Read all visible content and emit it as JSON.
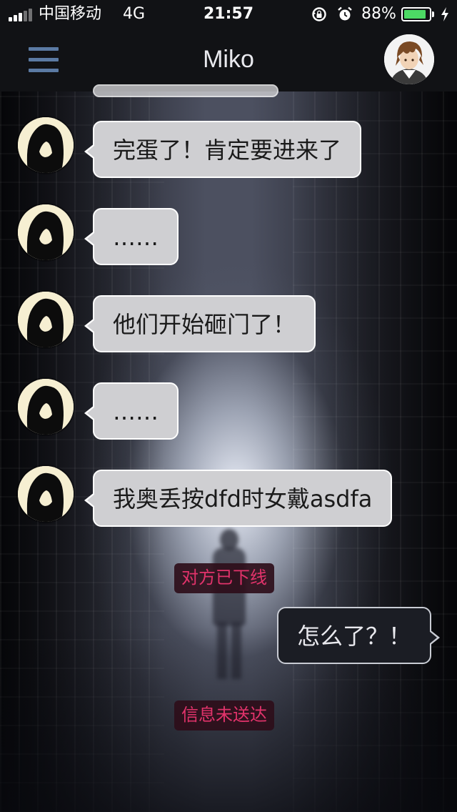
{
  "status_bar": {
    "carrier": "中国移动",
    "network": "4G",
    "time": "21:57",
    "battery_percent": "88%",
    "battery_level": 0.88,
    "icons": [
      "signal-bars-icon",
      "rotation-lock-icon",
      "alarm-icon",
      "battery-icon",
      "charging-bolt-icon"
    ]
  },
  "nav": {
    "title": "Miko",
    "menu_icon": "hamburger-menu-icon",
    "avatar_icon": "contact-avatar"
  },
  "messages": [
    {
      "from": "other",
      "text": "完蛋了！肯定要进来了"
    },
    {
      "from": "other",
      "text": "……"
    },
    {
      "from": "other",
      "text": "他们开始砸门了！"
    },
    {
      "from": "other",
      "text": "……"
    },
    {
      "from": "other",
      "text": "我奥丢按dfd时女戴asdfa"
    },
    {
      "from": "system",
      "text": "对方已下线"
    },
    {
      "from": "me",
      "text": "怎么了？！"
    },
    {
      "from": "system",
      "text": "信息未送达"
    }
  ],
  "colors": {
    "bar_background": "#111215",
    "menu_icon": "#5b7aa3",
    "incoming_bubble": "#cfcfd2",
    "outgoing_bubble": "#1b1d24",
    "system_text": "#e2336b",
    "battery_fill": "#4cd964"
  }
}
